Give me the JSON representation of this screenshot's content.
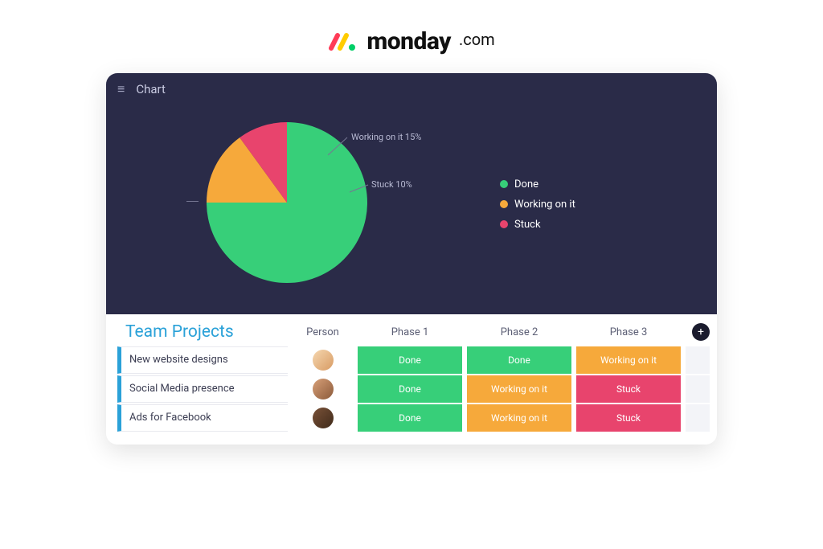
{
  "brand": {
    "word": "monday",
    "suffix": ".com"
  },
  "colors": {
    "done": "#37cf79",
    "working": "#f6a93b",
    "stuck": "#e8446d",
    "brand_red": "#ff3b57",
    "brand_yellow": "#ffcc00",
    "brand_green": "#00cf67",
    "header_accent": "#2aa1d8"
  },
  "chart": {
    "panel_title": "Chart",
    "labels": {
      "working": "Working on it 15%",
      "stuck": "Stuck 10%"
    },
    "legend": [
      {
        "key": "done",
        "label": "Done"
      },
      {
        "key": "working",
        "label": "Working on it"
      },
      {
        "key": "stuck",
        "label": "Stuck"
      }
    ]
  },
  "chart_data": {
    "type": "pie",
    "title": "Chart",
    "series": [
      {
        "name": "Done",
        "value": 75,
        "color": "#37cf79"
      },
      {
        "name": "Working on it",
        "value": 15,
        "color": "#f6a93b"
      },
      {
        "name": "Stuck",
        "value": 10,
        "color": "#e8446d"
      }
    ]
  },
  "table": {
    "title": "Team Projects",
    "columns": [
      "Person",
      "Phase 1",
      "Phase 2",
      "Phase 3"
    ],
    "rows": [
      {
        "task": "New website designs",
        "avatar": "linear-gradient(135deg,#f5d7b0,#d89b63)",
        "phases": [
          "Done",
          "Done",
          "Working on it"
        ]
      },
      {
        "task": "Social Media presence",
        "avatar": "linear-gradient(135deg,#d8a078,#8b5a3a)",
        "phases": [
          "Done",
          "Working on it",
          "Stuck"
        ]
      },
      {
        "task": "Ads for Facebook",
        "avatar": "linear-gradient(135deg,#7a5238,#3f2a1a)",
        "phases": [
          "Done",
          "Working on it",
          "Stuck"
        ]
      }
    ],
    "status_styles": {
      "Done": "done",
      "Working on it": "working",
      "Stuck": "stuck"
    }
  }
}
